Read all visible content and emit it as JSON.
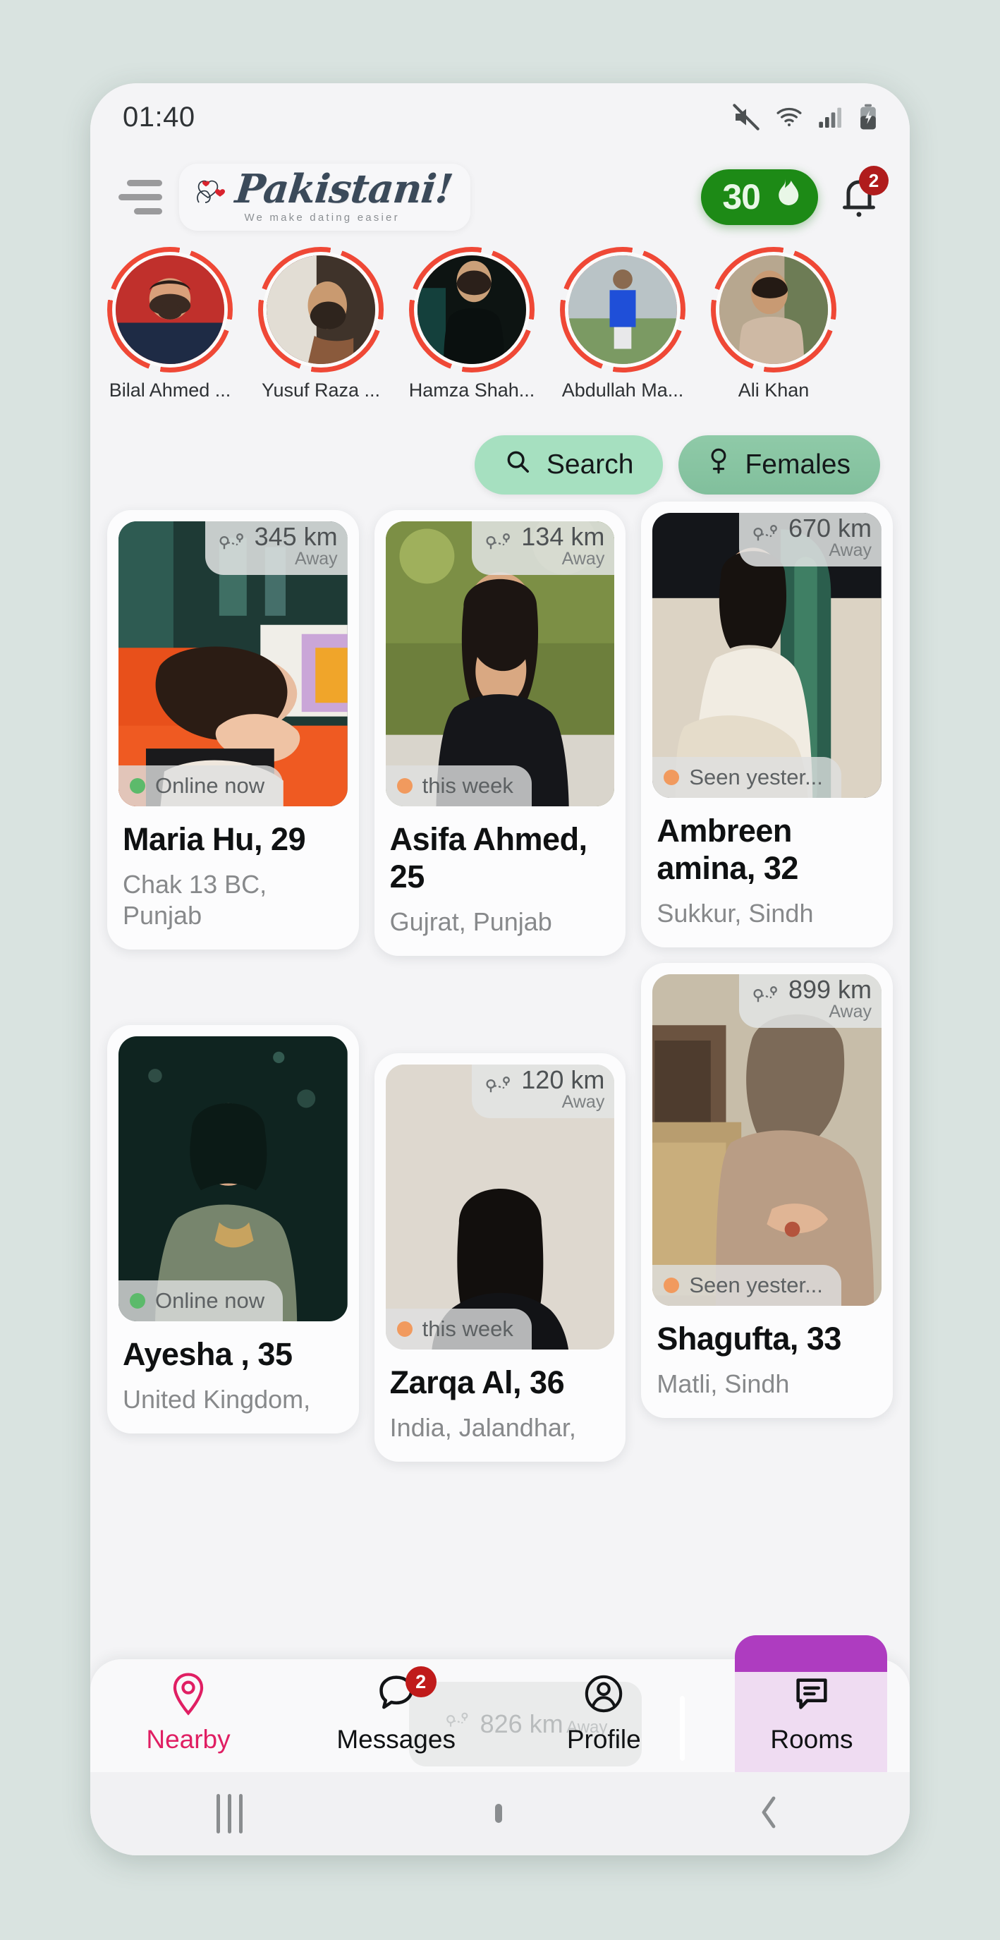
{
  "status_bar": {
    "clock": "01:40",
    "icons": [
      "mute-icon",
      "wifi-icon",
      "signal-icon",
      "battery-charging-icon"
    ]
  },
  "header": {
    "menu_icon": "hamburger-icon",
    "logo_text": "Pakistani!",
    "logo_tagline": "We make dating easier",
    "credits_count": "30",
    "credits_icon": "flame-icon",
    "bell_icon": "bell-icon",
    "bell_badge": "2"
  },
  "stories": [
    {
      "name": "Bilal Ahmed ..."
    },
    {
      "name": "Yusuf Raza ..."
    },
    {
      "name": "Hamza Shah..."
    },
    {
      "name": "Abdullah Ma..."
    },
    {
      "name": "Ali Khan"
    }
  ],
  "filters": {
    "search_label": "Search",
    "search_icon": "search-icon",
    "gender_label": "Females",
    "gender_icon": "female-symbol-icon"
  },
  "profiles": [
    {
      "distance": "345 km",
      "away_label": "Away",
      "status": "Online now",
      "status_color": "#5cba6b",
      "name": "Maria Hu, 29",
      "location": "Chak 13 BC, Punjab"
    },
    {
      "distance": "134 km",
      "away_label": "Away",
      "status": "this week",
      "status_color": "#f19a5e",
      "name": "Asifa Ahmed, 25",
      "location": "Gujrat, Punjab"
    },
    {
      "distance": "670 km",
      "away_label": "Away",
      "status": "Seen yester...",
      "status_color": "#f19a5e",
      "name": "Ambreen amina, 32",
      "location": "Sukkur, Sindh"
    },
    {
      "distance": "",
      "away_label": "",
      "status": "Online now",
      "status_color": "#5cba6b",
      "name": "Ayesha , 35",
      "location": "United Kingdom,"
    },
    {
      "distance": "120 km",
      "away_label": "Away",
      "status": "this week",
      "status_color": "#f19a5e",
      "name": "Zarqa Al, 36",
      "location": "India, Jalandhar,"
    },
    {
      "distance": "899 km",
      "away_label": "Away",
      "status": "Seen yester...",
      "status_color": "#f19a5e",
      "name": "Shagufta, 33",
      "location": "Matli, Sindh"
    }
  ],
  "partial_card": {
    "distance": "826 km",
    "away_label": "Away"
  },
  "bottom_nav": {
    "items": [
      {
        "label": "Nearby",
        "icon": "location-pin-icon"
      },
      {
        "label": "Messages",
        "icon": "chat-bubble-icon",
        "badge": "2"
      },
      {
        "label": "Profile",
        "icon": "person-circle-icon"
      },
      {
        "label": "Rooms",
        "icon": "message-lines-icon"
      }
    ],
    "active_color": "#e01f63"
  },
  "system_nav": {
    "recents_icon": "recents-icon",
    "home_icon": "home-icon",
    "back_icon": "back-icon"
  },
  "theme": {
    "page_bg": "#d9e3e0",
    "accent_green": "#1d8a16",
    "accent_pink": "#e01f63",
    "accent_purple": "#ae3cc0",
    "story_ring": "#ef4836"
  }
}
